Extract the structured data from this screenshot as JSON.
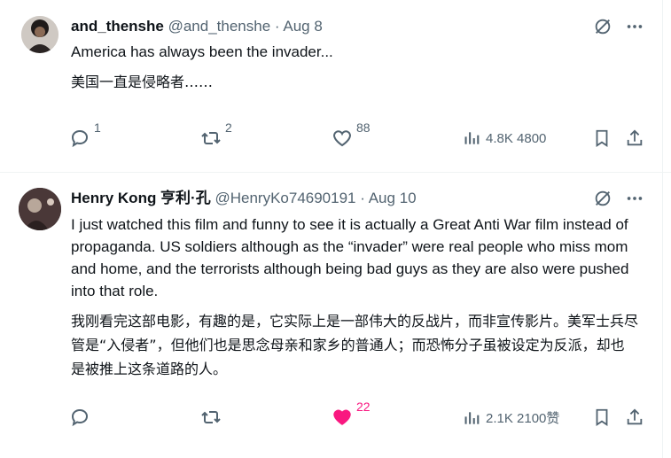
{
  "tweets": [
    {
      "name": "and_thenshe",
      "handle": "@and_thenshe",
      "separator": "·",
      "date": "Aug 8",
      "text_en": "America has always been the invader...",
      "text_zh": "美国一直是侵略者……",
      "replies": "1",
      "retweets": "2",
      "likes": "88",
      "views": "4.8K 4800",
      "liked": false
    },
    {
      "name": "Henry Kong 亨利·孔",
      "handle": "@HenryKo74690191",
      "separator": "·",
      "date": "Aug 10",
      "text_en": "I just watched this film and funny to see it is actually a Great Anti War film instead of propaganda. US soldiers although as the “invader” were real people who miss mom and home, and the terrorists although being bad guys as they are also were pushed into that role.",
      "text_zh": "我刚看完这部电影，有趣的是，它实际上是一部伟大的反战片，而非宣传影片。美军士兵尽管是“入侵者”，但他们也是思念母亲和家乡的普通人；而恐怖分子虽被设定为反派，却也是被推上这条道路的人。",
      "replies": "",
      "retweets": "",
      "likes": "22",
      "views": "2.1K 2100赞",
      "liked": true
    }
  ],
  "colors": {
    "text": "#0f1419",
    "muted": "#536471",
    "like": "#f91880",
    "border": "#eff3f4"
  },
  "icons": [
    "grok-icon",
    "more-icon",
    "reply-icon",
    "retweet-icon",
    "heart-icon",
    "views-icon",
    "bookmark-icon",
    "share-icon"
  ]
}
